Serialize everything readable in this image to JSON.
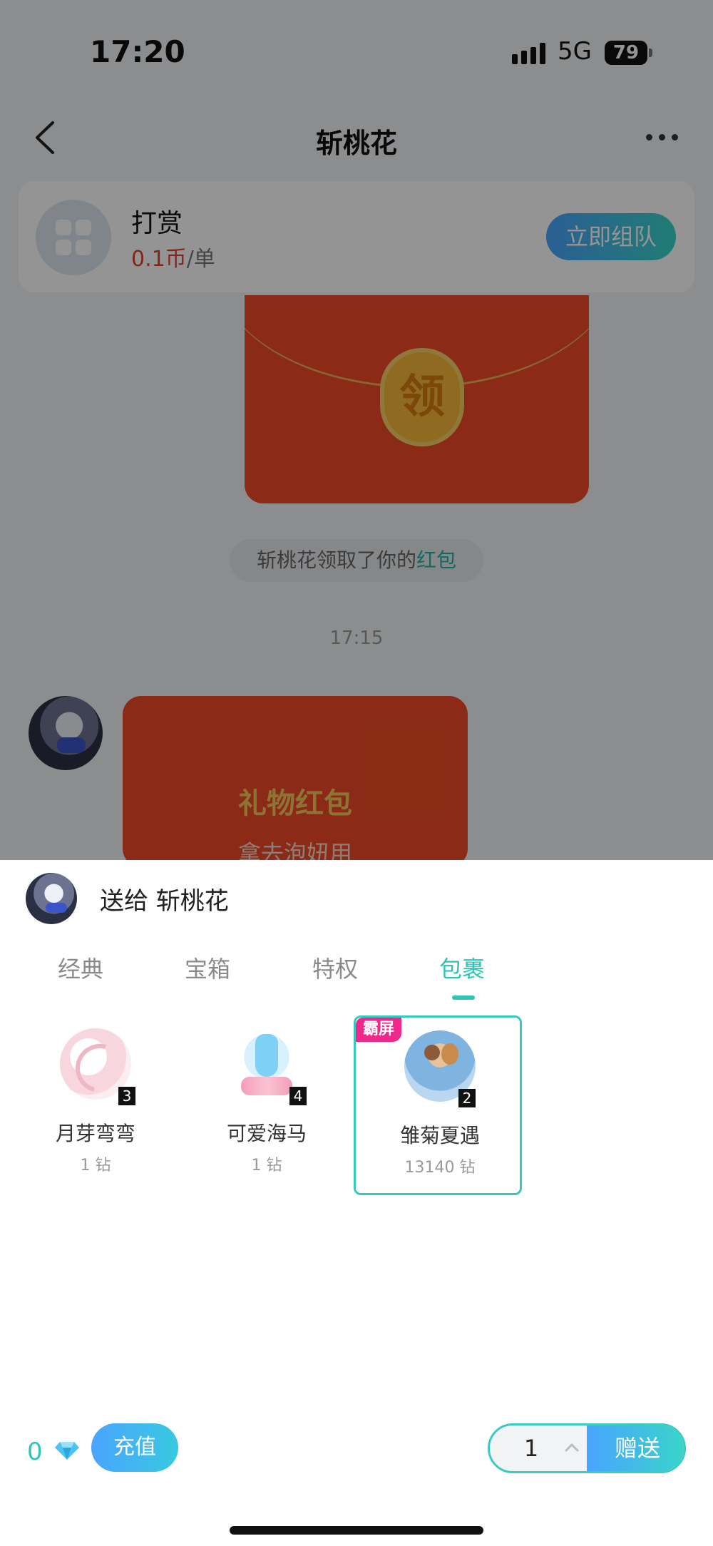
{
  "status_bar": {
    "time": "17:20",
    "network": "5G",
    "battery": "79"
  },
  "chat": {
    "title": "斩桃花",
    "reward": {
      "title": "打赏",
      "price": "0.1币",
      "unit": "/单",
      "button": "立即组队"
    },
    "red_packet_seal": "领",
    "notice_prefix": "斩桃花领取了你的",
    "notice_link": "红包",
    "time": "17:15",
    "gift_packet": {
      "title": "礼物红包",
      "subtitle": "拿去泡妞用"
    }
  },
  "sheet": {
    "send_to": "送给 斩桃花",
    "tabs": [
      "经典",
      "宝箱",
      "特权",
      "包裹"
    ],
    "active_tab": "包裹",
    "gifts": [
      {
        "name": "月芽弯弯",
        "price": "1 钻",
        "count": "3",
        "icon": "crescent-moon-icon"
      },
      {
        "name": "可爱海马",
        "price": "1 钻",
        "count": "4",
        "icon": "seahorse-icon"
      },
      {
        "name": "雏菊夏遇",
        "price": "13140 钻",
        "count": "2",
        "badge": "霸屏",
        "icon": "couple-icon"
      }
    ],
    "balance": "0",
    "recharge_label": "充值",
    "quantity": "1",
    "send_label": "赠送"
  },
  "colors": {
    "accent": "#2ec4b6",
    "red_packet": "#f04b28",
    "badge": "#f0288b"
  }
}
